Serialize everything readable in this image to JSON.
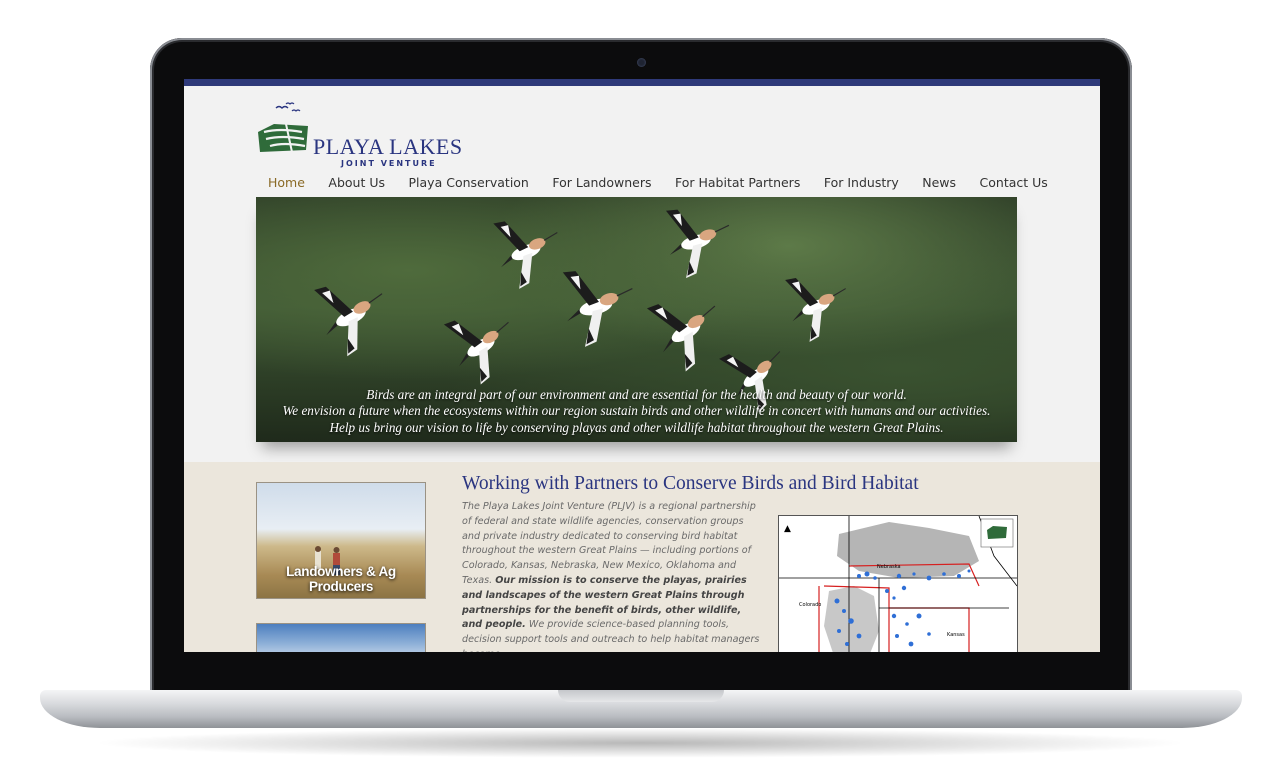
{
  "site": {
    "logo_title": "PLAYA LAKES",
    "logo_subtitle": "JOINT VENTURE"
  },
  "nav": {
    "items": [
      {
        "label": "Home",
        "active": true
      },
      {
        "label": "About Us"
      },
      {
        "label": "Playa Conservation"
      },
      {
        "label": "For Landowners"
      },
      {
        "label": "For Habitat Partners"
      },
      {
        "label": "For Industry"
      },
      {
        "label": "News"
      },
      {
        "label": "Contact Us"
      }
    ]
  },
  "hero": {
    "caption_lines": [
      "Birds are an integral part of our environment and are essential for the health and beauty of our world.",
      "We envision a future when the ecosystems within our region sustain birds and other wildlife in concert with humans and our activities.",
      "Help us bring our vision to life by conserving playas and other wildlife habitat throughout the western Great Plains."
    ]
  },
  "cards": {
    "landowners_label": "Landowners & Ag Producers"
  },
  "main": {
    "headline": "Working with Partners to Conserve Birds and Bird Habitat",
    "intro": "The Playa Lakes Joint Venture (PLJV) is a regional partnership of federal and state wildlife agencies, conservation groups and private industry dedicated to conserving bird habitat throughout the western Great Plains — including portions of Colorado, Kansas, Nebraska, New Mexico, Oklahoma and Texas.",
    "mission": "Our mission is to conserve the playas, prairies and landscapes of the western Great Plains through partnerships for the benefit of birds, other wildlife, and people.",
    "outro": "We provide science-based planning tools, decision support tools and outreach to help habitat managers become"
  },
  "map": {
    "labels": {
      "nebraska": "Nebraska",
      "colorado": "Colorado",
      "kansas": "Kansas"
    },
    "colors": {
      "playas": "#2f6fd6",
      "boundary": "#d62020",
      "range": "#b5b5b5"
    }
  },
  "colors": {
    "brand_navy": "#2a3580",
    "nav_active": "#8a6a26",
    "logo_green": "#2f6b3a"
  }
}
